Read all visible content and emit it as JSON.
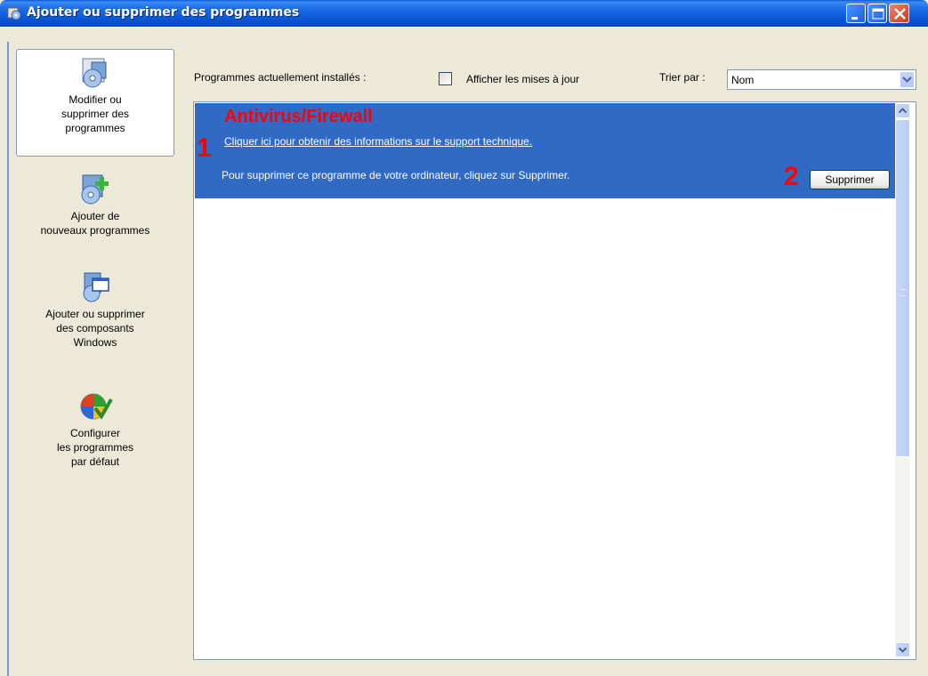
{
  "window": {
    "title": "Ajouter ou supprimer des programmes",
    "minimize_icon": "minimize-icon",
    "maximize_icon": "maximize-icon",
    "close_icon": "close-icon"
  },
  "sidebar": {
    "items": [
      {
        "label": "Modifier ou\nsupprimer des\nprogrammes",
        "icon": "modify-remove-programs-icon",
        "selected": true
      },
      {
        "label": "Ajouter de\nnouveaux programmes",
        "icon": "add-programs-icon",
        "selected": false
      },
      {
        "label": "Ajouter ou supprimer\ndes composants\nWindows",
        "icon": "windows-components-icon",
        "selected": false
      },
      {
        "label": "Configurer\nles programmes\npar défaut",
        "icon": "default-programs-icon",
        "selected": false
      }
    ]
  },
  "header": {
    "installed_label": "Programmes actuellement installés :",
    "show_updates_label": "Afficher les mises à jour",
    "show_updates_checked": false,
    "sort_label": "Trier par :",
    "sort_value": "Nom"
  },
  "program": {
    "name": "Antivirus/Firewall",
    "support_link": "Cliquer ici pour obtenir des informations sur le support technique.",
    "remove_text": "Pour supprimer ce programme de votre ordinateur, cliquez sur Supprimer.",
    "remove_button": "Supprimer",
    "annotation_1": "1",
    "annotation_2": "2"
  },
  "colors": {
    "selection": "#316ac5",
    "annotation": "#ff0000",
    "title_bar": "#0a58d6"
  }
}
